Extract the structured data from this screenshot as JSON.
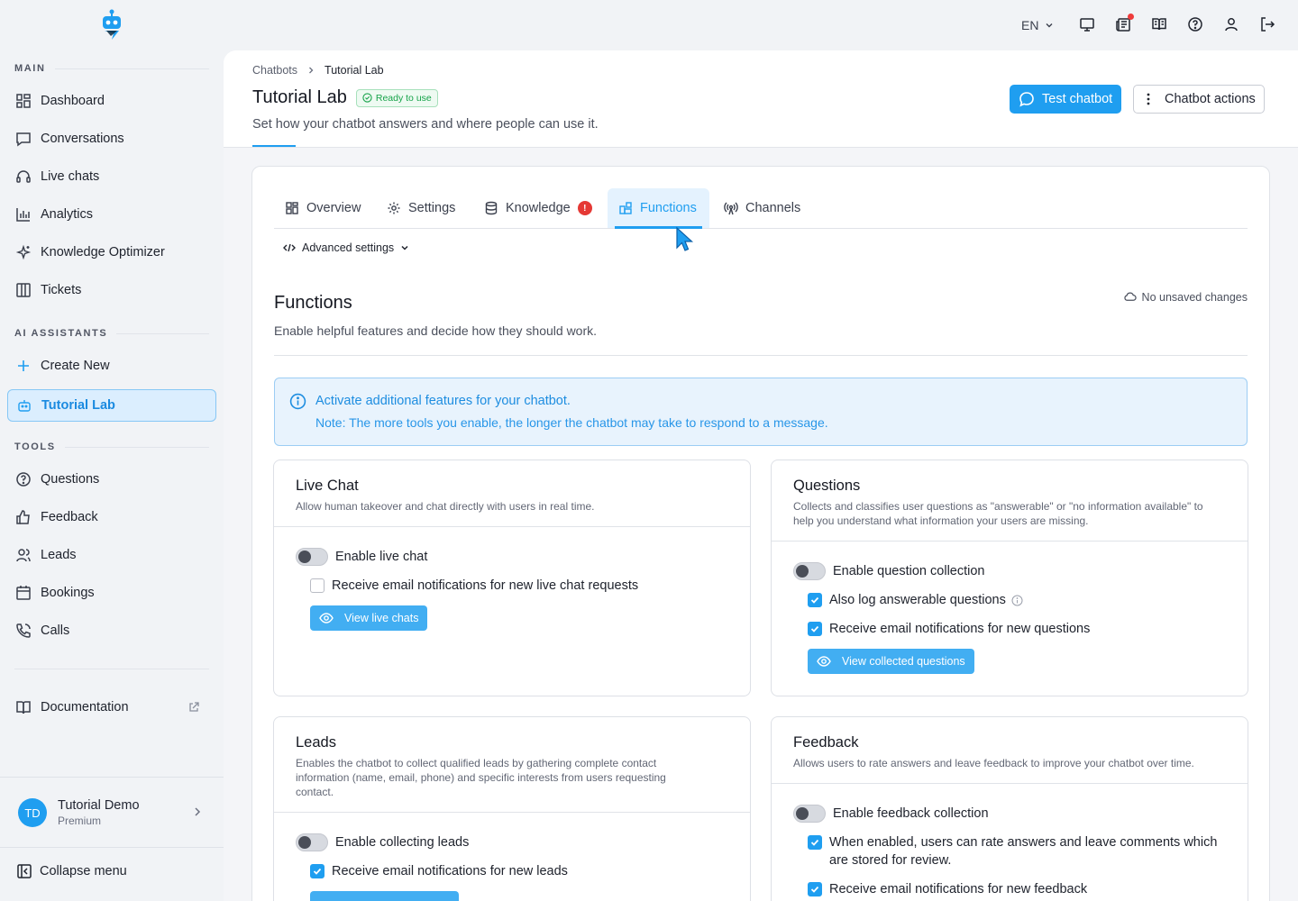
{
  "sidebar": {
    "sections": {
      "main": "MAIN",
      "ai": "AI ASSISTANTS",
      "tools": "TOOLS"
    },
    "main_items": [
      {
        "label": "Dashboard",
        "icon": "dashboard-icon"
      },
      {
        "label": "Conversations",
        "icon": "chat-bubble-icon"
      },
      {
        "label": "Live chats",
        "icon": "headset-icon"
      },
      {
        "label": "Analytics",
        "icon": "bar-chart-icon"
      },
      {
        "label": "Knowledge Optimizer",
        "icon": "sparkle-icon"
      },
      {
        "label": "Tickets",
        "icon": "columns-icon"
      }
    ],
    "ai_items": [
      {
        "label": "Create New",
        "icon": "plus-icon"
      },
      {
        "label": "Tutorial Lab",
        "icon": "bot-icon",
        "active": true
      }
    ],
    "tools_items": [
      {
        "label": "Questions",
        "icon": "question-circle-icon"
      },
      {
        "label": "Feedback",
        "icon": "thumbs-up-icon"
      },
      {
        "label": "Leads",
        "icon": "users-icon"
      },
      {
        "label": "Bookings",
        "icon": "calendar-icon"
      },
      {
        "label": "Calls",
        "icon": "phone-icon"
      }
    ],
    "documentation": "Documentation",
    "user": {
      "initials": "TD",
      "name": "Tutorial Demo",
      "plan": "Premium"
    },
    "collapse": "Collapse menu"
  },
  "topbar": {
    "language": "EN"
  },
  "header": {
    "breadcrumb": [
      "Chatbots",
      "Tutorial Lab"
    ],
    "title": "Tutorial Lab",
    "status": "Ready to use",
    "subtitle": "Set how your chatbot answers and where people can use it.",
    "test_button": "Test chatbot",
    "actions_button": "Chatbot actions"
  },
  "tabs": [
    {
      "label": "Overview",
      "icon": "grid-icon"
    },
    {
      "label": "Settings",
      "icon": "gear-icon"
    },
    {
      "label": "Knowledge",
      "icon": "database-icon",
      "alert": "!"
    },
    {
      "label": "Functions",
      "icon": "puzzle-icon",
      "active": true
    },
    {
      "label": "Channels",
      "icon": "broadcast-icon"
    }
  ],
  "advanced": "Advanced settings",
  "functions": {
    "title": "Functions",
    "subtitle": "Enable helpful features and decide how they should work.",
    "save_state": "No unsaved changes",
    "info_title": "Activate additional features for your chatbot.",
    "info_note": "Note: The more tools you enable, the longer the chatbot may take to respond to a message."
  },
  "cards": {
    "live_chat": {
      "title": "Live Chat",
      "desc": "Allow human takeover and chat directly with users in real time.",
      "toggle": "Enable live chat",
      "toggle_on": false,
      "check1": "Receive email notifications for new live chat requests",
      "check1_on": false,
      "button": "View live chats"
    },
    "questions": {
      "title": "Questions",
      "desc": "Collects and classifies user questions as \"answerable\" or \"no information available\" to help you understand what information your users are missing.",
      "toggle": "Enable question collection",
      "toggle_on": false,
      "check1": "Also log answerable questions",
      "check1_on": true,
      "check2": "Receive email notifications for new questions",
      "check2_on": true,
      "button": "View collected questions"
    },
    "leads": {
      "title": "Leads",
      "desc": "Enables the chatbot to collect qualified leads by gathering complete contact information (name, email, phone) and specific interests from users requesting contact.",
      "toggle": "Enable collecting leads",
      "toggle_on": false,
      "check1": "Receive email notifications for new leads",
      "check1_on": true
    },
    "feedback": {
      "title": "Feedback",
      "desc": "Allows users to rate answers and leave feedback to improve your chatbot over time.",
      "toggle": "Enable feedback collection",
      "toggle_on": false,
      "check1": "When enabled, users can rate answers and leave comments which are stored for review.",
      "check1_on": true,
      "check2": "Receive email notifications for new feedback",
      "check2_on": true
    }
  },
  "colors": {
    "accent": "#1f9ef0",
    "success": "#17a34a",
    "alert": "#e53935"
  }
}
